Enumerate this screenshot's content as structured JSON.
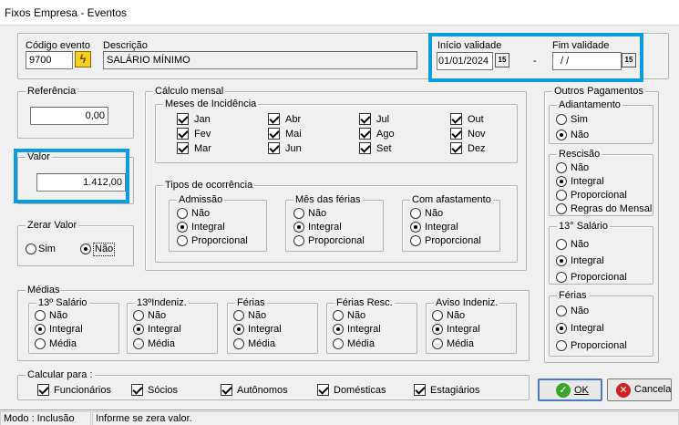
{
  "window": {
    "title": "Fixos Empresa - Eventos"
  },
  "header": {
    "codigo_label": "Código evento",
    "codigo_value": "9700",
    "descricao_label": "Descrição",
    "descricao_value": "SALÁRIO MÍNIMO",
    "inicio_label": "Início validade",
    "inicio_value": "01/01/2024",
    "fim_label": "Fim validade",
    "fim_value": " /  /",
    "dash": "-"
  },
  "referencia": {
    "title": "Referência",
    "value": "0,00"
  },
  "valor": {
    "title": "Valor",
    "value": "1.412,00"
  },
  "zerar": {
    "title": "Zerar Valor",
    "options": [
      "Sim",
      "Não"
    ],
    "selected": "Não"
  },
  "calculo": {
    "title": "Cálculo mensal",
    "meses_title": "Meses de Incidência",
    "meses": [
      "Jan",
      "Fev",
      "Mar",
      "Abr",
      "Mai",
      "Jun",
      "Jul",
      "Ago",
      "Set",
      "Out",
      "Nov",
      "Dez"
    ],
    "tipos_title": "Tipos de ocorrência",
    "admissao": {
      "title": "Admissão",
      "options": [
        "Não",
        "Integral",
        "Proporcional"
      ],
      "selected": "Integral"
    },
    "mes_ferias": {
      "title": "Mês das férias",
      "options": [
        "Não",
        "Integral",
        "Proporcional"
      ],
      "selected": "Integral"
    },
    "afastamento": {
      "title": "Com afastamento",
      "options": [
        "Não",
        "Integral",
        "Proporcional"
      ],
      "selected": "Integral"
    }
  },
  "outros": {
    "title": "Outros Pagamentos",
    "adiantamento": {
      "title": "Adiantamento",
      "options": [
        "Sim",
        "Não"
      ],
      "selected": "Não"
    },
    "rescisao": {
      "title": "Rescisão",
      "options": [
        "Não",
        "Integral",
        "Proporcional",
        "Regras do Mensal"
      ],
      "selected": "Integral"
    },
    "decimo": {
      "title": "13° Salário",
      "options": [
        "Não",
        "Integral",
        "Proporcional"
      ],
      "selected": "Integral"
    },
    "ferias": {
      "title": "Férias",
      "options": [
        "Não",
        "Integral",
        "Proporcional"
      ],
      "selected": "Integral"
    }
  },
  "medias": {
    "title": "Médias",
    "groups": [
      {
        "title": "13º Salário",
        "options": [
          "Não",
          "Integral",
          "Média"
        ],
        "selected": "Integral"
      },
      {
        "title": "13ºIndeniz.",
        "options": [
          "Não",
          "Integral",
          "Média"
        ],
        "selected": "Integral"
      },
      {
        "title": "Férias",
        "options": [
          "Não",
          "Integral",
          "Média"
        ],
        "selected": "Integral"
      },
      {
        "title": "Férias Resc.",
        "options": [
          "Não",
          "Integral",
          "Média"
        ],
        "selected": "Integral"
      },
      {
        "title": "Aviso Indeniz.",
        "options": [
          "Não",
          "Integral",
          "Média"
        ],
        "selected": "Integral"
      }
    ]
  },
  "calcular": {
    "title": "Calcular para :",
    "items": [
      "Funcionários",
      "Sócios",
      "Autônomos",
      "Domésticas",
      "Estagiários"
    ]
  },
  "buttons": {
    "ok": "OK",
    "cancel": "Cancela"
  },
  "statusbar": {
    "mode": "Modo : Inclusão",
    "hint": "Informe se zera valor."
  },
  "colors": {
    "highlight": "#0a9be0",
    "ok_icon": "#3aa52a",
    "cancel_icon": "#d42020"
  }
}
